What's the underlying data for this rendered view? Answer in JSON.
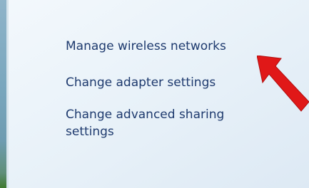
{
  "tasks": {
    "manage_wireless": "Manage wireless networks",
    "change_adapter": "Change adapter settings",
    "change_sharing": "Change advanced sharing settings"
  },
  "colors": {
    "link_text": "#1e3a6e",
    "pane_background": "#e9f2f9",
    "arrow": "#e01818"
  },
  "icons": {
    "pointer": "red-arrow-icon"
  }
}
